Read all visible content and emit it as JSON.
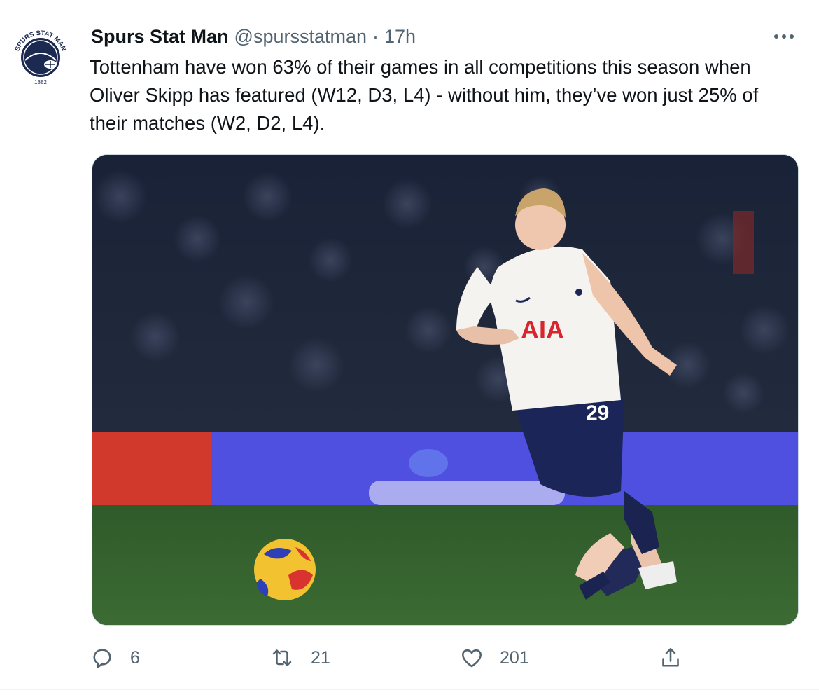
{
  "tweet": {
    "display_name": "Spurs Stat Man",
    "handle": "@spursstatman",
    "separator": "·",
    "time": "17h",
    "text": "Tottenham have won 63% of their games in all competitions this season when Oliver Skipp has featured (W12, D3, L4) - without him, they’ve won just 25% of their matches (W2, D2, L4)."
  },
  "avatar": {
    "logo_text": "SPURS STAT MAN",
    "year": "1882"
  },
  "photo": {
    "shirt_sponsor": "AIA",
    "shirt_number": "29"
  },
  "actions": {
    "replies": "6",
    "retweets": "21",
    "likes": "201"
  },
  "icons": {
    "reply": "reply-icon",
    "retweet": "retweet-icon",
    "like": "heart-icon",
    "share": "share-icon",
    "more": "more-icon"
  },
  "colors": {
    "text": "#0f1419",
    "secondary": "#536471",
    "border": "#cfd9de",
    "logo_navy": "#1c2a52"
  }
}
